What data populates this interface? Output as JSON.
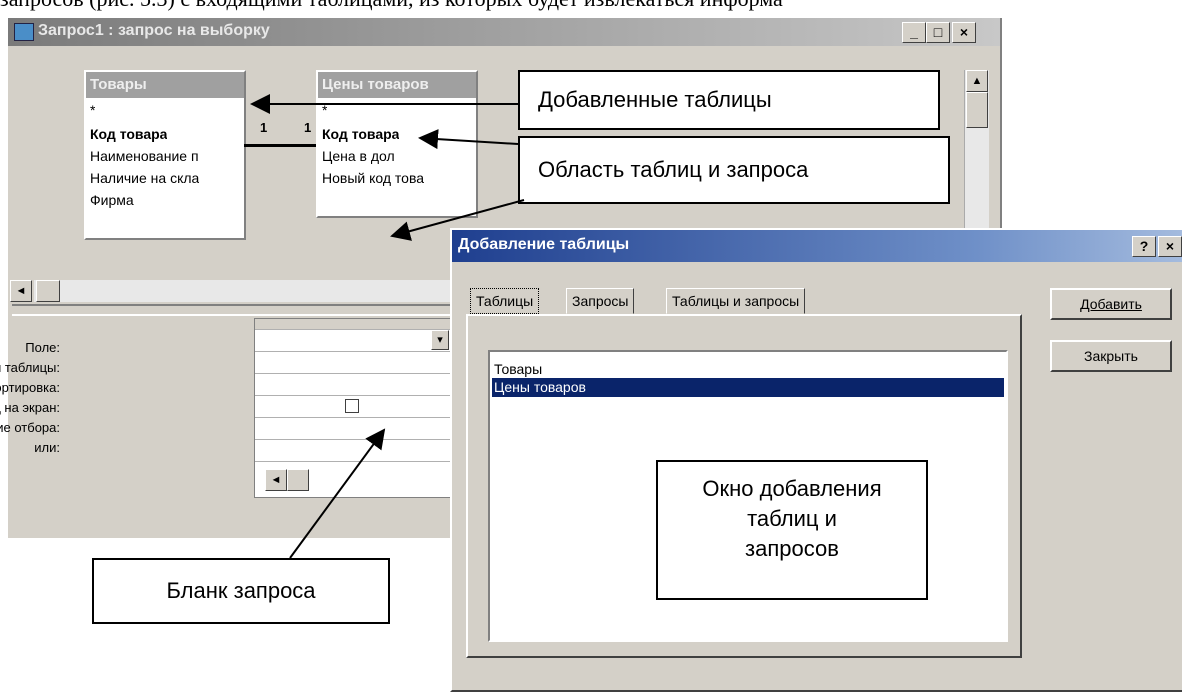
{
  "caption_top": "запросов (рис. 5.3) с входящими таблицами, из которых будет извлекаться информа",
  "query_window": {
    "title": "Запрос1 : запрос на выборку",
    "buttons": {
      "minimize": "_",
      "maximize": "□",
      "close": "×"
    },
    "tables": [
      {
        "name": "Товары",
        "fields": [
          "*",
          "Код товара",
          "Наименование п",
          "Наличие на скла",
          "Фирма"
        ]
      },
      {
        "name": "Цены товаров",
        "fields": [
          "*",
          "Код товара",
          "Цена в дол",
          "Новый код това"
        ]
      }
    ],
    "relation": {
      "left": "1",
      "right": "1"
    },
    "grid_rows": [
      "Поле:",
      "Имя таблицы:",
      "Сортировка:",
      "Вывод на экран:",
      "Условие отбора:",
      "или:"
    ]
  },
  "dialog": {
    "title": "Добавление таблицы",
    "help": "?",
    "close": "×",
    "tabs": [
      "Таблицы",
      "Запросы",
      "Таблицы и запросы"
    ],
    "list": [
      "Товары",
      "Цены товаров"
    ],
    "selected_index": 1,
    "buttons": {
      "add": "Добавить",
      "close": "Закрыть"
    }
  },
  "callouts": {
    "added_tables": "Добавленные таблицы",
    "table_area": "Область таблиц и запроса",
    "dialog_window_l1": "Окно добавления",
    "dialog_window_l2": "таблиц и",
    "dialog_window_l3": "запросов",
    "query_form": "Бланк запроса"
  },
  "colors": {
    "titlebar_active": "#1f3f8f",
    "selection": "#0a246a",
    "window_bg": "#d4d0c8"
  }
}
